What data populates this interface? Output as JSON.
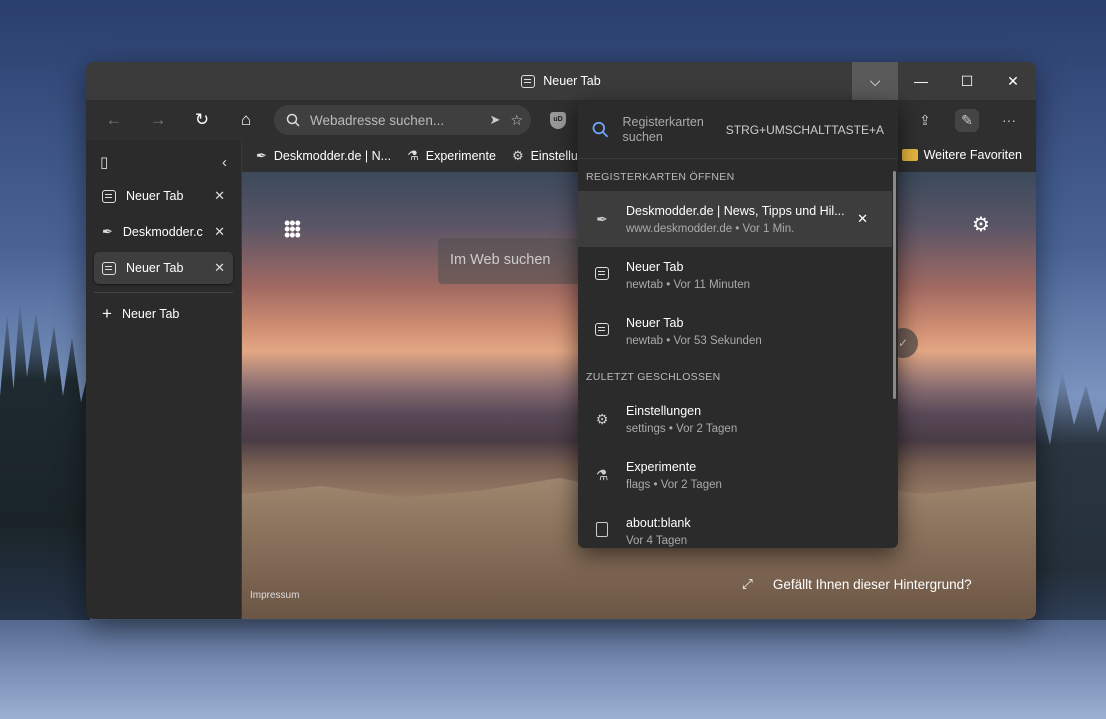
{
  "window": {
    "title": "Neuer Tab",
    "controls": {
      "dropdown": "⌵",
      "minimize": "—",
      "maximize": "☐",
      "close": "✕"
    }
  },
  "toolbar": {
    "back": "←",
    "forward": "→",
    "refresh": "↻",
    "home": "⌂",
    "address_placeholder": "Webadresse suchen...",
    "shield_label": "uD",
    "more": "···"
  },
  "favorites": {
    "items": [
      {
        "label": "Deskmodder.de | N...",
        "icon": "feather-icon"
      },
      {
        "label": "Experimente",
        "icon": "flask-icon"
      },
      {
        "label": "Einstellu",
        "icon": "gear-icon"
      }
    ],
    "more_label": "Weitere Favoriten"
  },
  "sidebar": {
    "tabs": [
      {
        "label": "Neuer Tab",
        "active": false
      },
      {
        "label": "Deskmodder.c",
        "active": false
      },
      {
        "label": "Neuer Tab",
        "active": true
      }
    ],
    "new_tab": "Neuer Tab"
  },
  "content": {
    "search_placeholder": "Im Web suchen",
    "impressum": "Impressum",
    "like_text": "Gefällt Ihnen dieser Hintergrund?"
  },
  "tabsearch": {
    "placeholder": "Registerkarten suchen",
    "shortcut": "STRG+UMSCHALTTASTE+A",
    "open_section": "REGISTERKARTEN ÖFFNEN",
    "open_items": [
      {
        "title": "Deskmodder.de | News, Tipps und Hil...",
        "sub": "www.deskmodder.de • Vor 1 Min.",
        "icon": "feather-icon"
      },
      {
        "title": "Neuer Tab",
        "sub": "newtab • Vor 11 Minuten",
        "icon": "newtab-icon"
      },
      {
        "title": "Neuer Tab",
        "sub": "newtab • Vor 53 Sekunden",
        "icon": "newtab-icon"
      }
    ],
    "closed_section": "ZULETZT GESCHLOSSEN",
    "closed_items": [
      {
        "title": "Einstellungen",
        "sub": "settings • Vor 2 Tagen",
        "icon": "gear-icon"
      },
      {
        "title": "Experimente",
        "sub": "flags • Vor 2 Tagen",
        "icon": "flask-icon"
      },
      {
        "title": "about:blank",
        "sub": "Vor 4 Tagen",
        "icon": "page-icon"
      }
    ]
  }
}
